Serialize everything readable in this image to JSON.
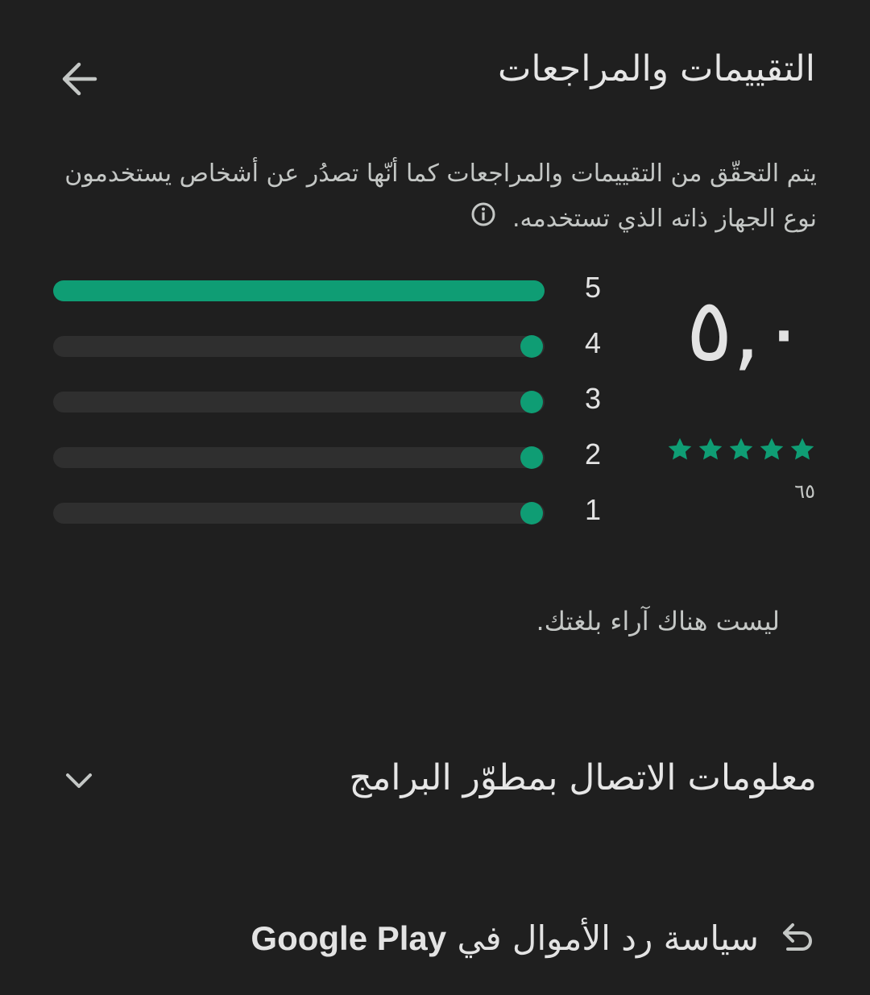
{
  "header": {
    "title": "التقييمات والمراجعات"
  },
  "description": {
    "text": "يتم التحقّق من التقييمات والمراجعات كما أنّها تصدُر عن أشخاص يستخدمون نوع الجهاز ذاته الذي تستخدمه."
  },
  "rating": {
    "score": "٥,٠",
    "stars": 5,
    "count": "٦٥",
    "accent_color": "#0f9d74",
    "histogram": [
      {
        "label": "5",
        "fraction": 1.0
      },
      {
        "label": "4",
        "fraction": 0.0
      },
      {
        "label": "3",
        "fraction": 0.0
      },
      {
        "label": "2",
        "fraction": 0.0
      },
      {
        "label": "1",
        "fraction": 0.0
      }
    ]
  },
  "reviews": {
    "empty_text": "ليست هناك آراء بلغتك."
  },
  "developer_contact": {
    "title": "معلومات الاتصال بمطوّر البرامج",
    "icon": "chevron-down-icon"
  },
  "refund": {
    "text": "سياسة رد الأموال في",
    "brand": "Google Play",
    "icon": "refund-arrow-icon"
  }
}
